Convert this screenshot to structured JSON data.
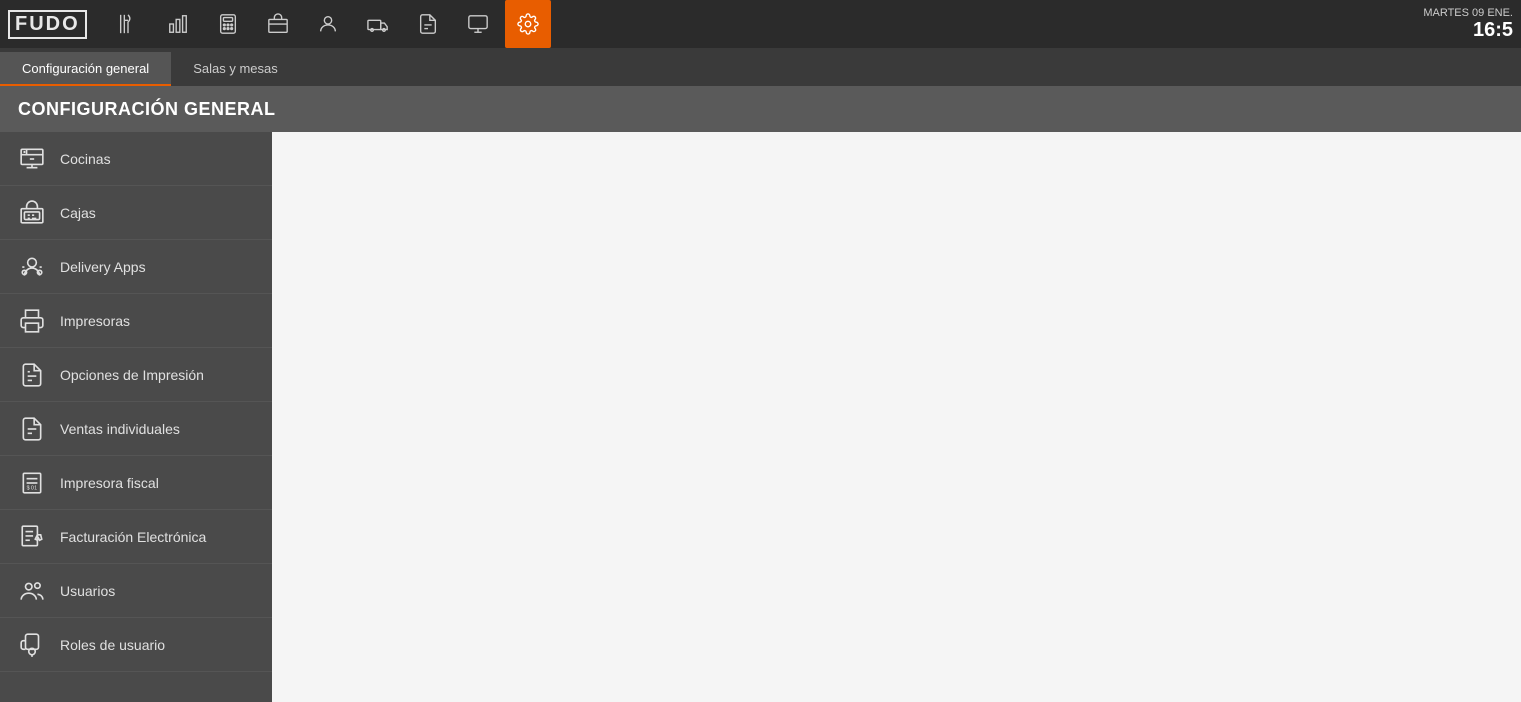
{
  "app": {
    "logo_text": "FUDO"
  },
  "datetime": {
    "day_date": "MARTES 09 ENE.",
    "time": "16:5"
  },
  "nav_icons": [
    {
      "name": "utensils-icon",
      "label": "Menú"
    },
    {
      "name": "chart-icon",
      "label": "Reportes"
    },
    {
      "name": "calculator-icon",
      "label": "Caja"
    },
    {
      "name": "products-icon",
      "label": "Productos"
    },
    {
      "name": "users-icon",
      "label": "Usuarios"
    },
    {
      "name": "delivery-icon",
      "label": "Delivery"
    },
    {
      "name": "documents-icon",
      "label": "Documentos"
    },
    {
      "name": "monitor-icon",
      "label": "Monitor"
    },
    {
      "name": "settings-icon",
      "label": "Configuración"
    }
  ],
  "tabs": [
    {
      "label": "Configuración general",
      "active": true
    },
    {
      "label": "Salas y mesas",
      "active": false
    }
  ],
  "page_title": "CONFIGURACIÓN GENERAL",
  "sidebar_items": [
    {
      "label": "Cocinas",
      "icon": "kitchen-icon"
    },
    {
      "label": "Cajas",
      "icon": "cash-register-icon"
    },
    {
      "label": "Delivery Apps",
      "icon": "delivery-apps-icon"
    },
    {
      "label": "Impresoras",
      "icon": "printer-icon"
    },
    {
      "label": "Opciones de Impresión",
      "icon": "print-options-icon"
    },
    {
      "label": "Ventas individuales",
      "icon": "individual-sales-icon"
    },
    {
      "label": "Impresora fiscal",
      "icon": "fiscal-printer-icon"
    },
    {
      "label": "Facturación Electrónica",
      "icon": "e-invoice-icon"
    },
    {
      "label": "Usuarios",
      "icon": "users-sidebar-icon"
    },
    {
      "label": "Roles de usuario",
      "icon": "roles-icon"
    }
  ]
}
